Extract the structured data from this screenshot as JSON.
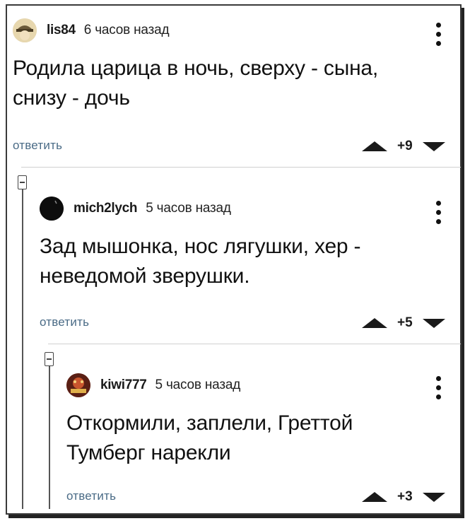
{
  "comments": [
    {
      "username": "lis84",
      "time": "6 часов назад",
      "avatar_icon": "hat-character-avatar",
      "text_line1": "Родила царица в ночь, сверху - сына,",
      "text_line2": "снизу - дочь",
      "reply_label": "ответить",
      "score": "+9"
    },
    {
      "username": "mich2lych",
      "time": "5 часов назад",
      "avatar_icon": "black-circle-avatar",
      "text_line1": "Зад мышонка, нос лягушки, хер -",
      "text_line2": "неведомой зверушки.",
      "reply_label": "ответить",
      "score": "+5"
    },
    {
      "username": "kiwi777",
      "time": "5 часов назад",
      "avatar_icon": "decorated-avatar",
      "text_line1": "Откормили, заплели, Греттой",
      "text_line2": "Тумберг нарекли",
      "reply_label": "ответить",
      "score": "+3"
    }
  ]
}
